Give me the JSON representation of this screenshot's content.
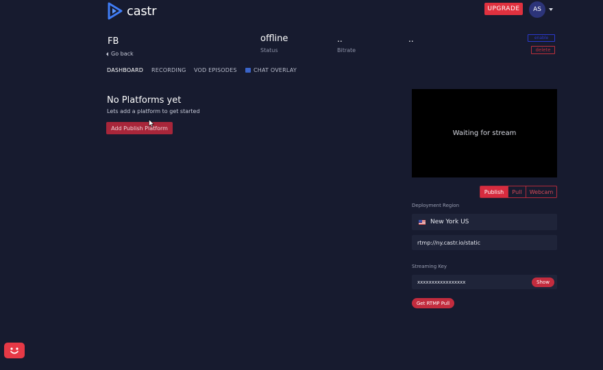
{
  "header": {
    "brand": "castr",
    "upgrade_label": "UPGRADE",
    "avatar_initials": "AS"
  },
  "stream": {
    "name": "FB",
    "go_back": "Go back",
    "status_value": "offline",
    "status_label": "Status",
    "bitrate_value": "..",
    "bitrate_label": "Bitrate",
    "extra_value": "..",
    "enable_label": "enable",
    "delete_label": "delete"
  },
  "tabs": [
    {
      "label": "DASHBOARD",
      "active": true
    },
    {
      "label": "RECORDING",
      "active": false
    },
    {
      "label": "VOD EPISODES",
      "active": false
    },
    {
      "label": "CHAT OVERLAY",
      "active": false
    }
  ],
  "empty_state": {
    "title": "No Platforms yet",
    "subtitle": "Lets add a platform to get started",
    "button": "Add Publish Platform"
  },
  "preview": {
    "text": "Waiting for stream"
  },
  "modes": [
    {
      "label": "Publish",
      "active": true
    },
    {
      "label": "Pull",
      "active": false
    },
    {
      "label": "Webcam",
      "active": false
    }
  ],
  "deployment": {
    "label": "Deployment Region",
    "region": "New York US",
    "rtmp_url": "rtmp://ny.castr.io/static"
  },
  "streaming_key": {
    "label": "Streaming Key",
    "masked": "xxxxxxxxxxxxxxxxx",
    "show_label": "Show"
  },
  "rtmp_pull_label": "Get RTMP Pull",
  "colors": {
    "background": "#171b2f",
    "accent_red": "#d72c3f",
    "avatar_blue": "#2c3479",
    "logo_blue": "#3f7cf5"
  }
}
